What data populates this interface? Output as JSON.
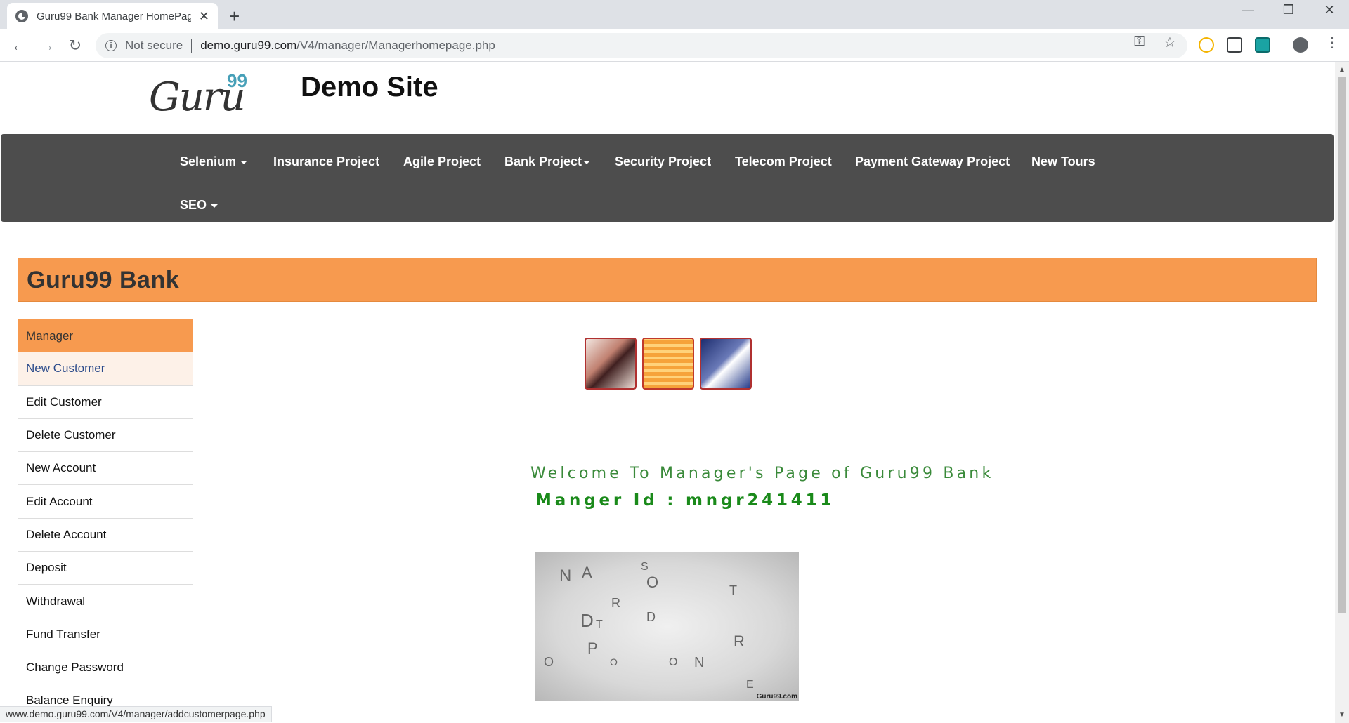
{
  "browser": {
    "tab_title": "Guru99 Bank Manager HomePage",
    "not_secure": "Not secure",
    "url_host": "demo.guru99.com",
    "url_path": "/V4/manager/Managerhomepage.php",
    "status_url": "www.demo.guru99.com/V4/manager/addcustomerpage.php"
  },
  "site": {
    "logo_text": "Guru",
    "logo_num": "99",
    "title": "Demo Site"
  },
  "nav": {
    "items": [
      "Selenium",
      "Insurance Project",
      "Agile Project",
      "Bank Project",
      "Security Project",
      "Telecom Project",
      "Payment Gateway Project",
      "New Tours",
      "SEO"
    ]
  },
  "bank": {
    "header": "Guru99 Bank"
  },
  "menu": {
    "items": [
      "Manager",
      "New Customer",
      "Edit Customer",
      "Delete Customer",
      "New Account",
      "Edit Account",
      "Delete Account",
      "Deposit",
      "Withdrawal",
      "Fund Transfer",
      "Change Password",
      "Balance Enquiry"
    ]
  },
  "main": {
    "welcome": "Welcome To Manager's Page of Guru99 Bank",
    "manager_id": "Manger Id : mngr241411",
    "image_watermark": "Guru99.com"
  },
  "colors": {
    "accent": "#f79a4f",
    "navbar": "#4d4d4d",
    "welcome": "#3a8a3a"
  }
}
